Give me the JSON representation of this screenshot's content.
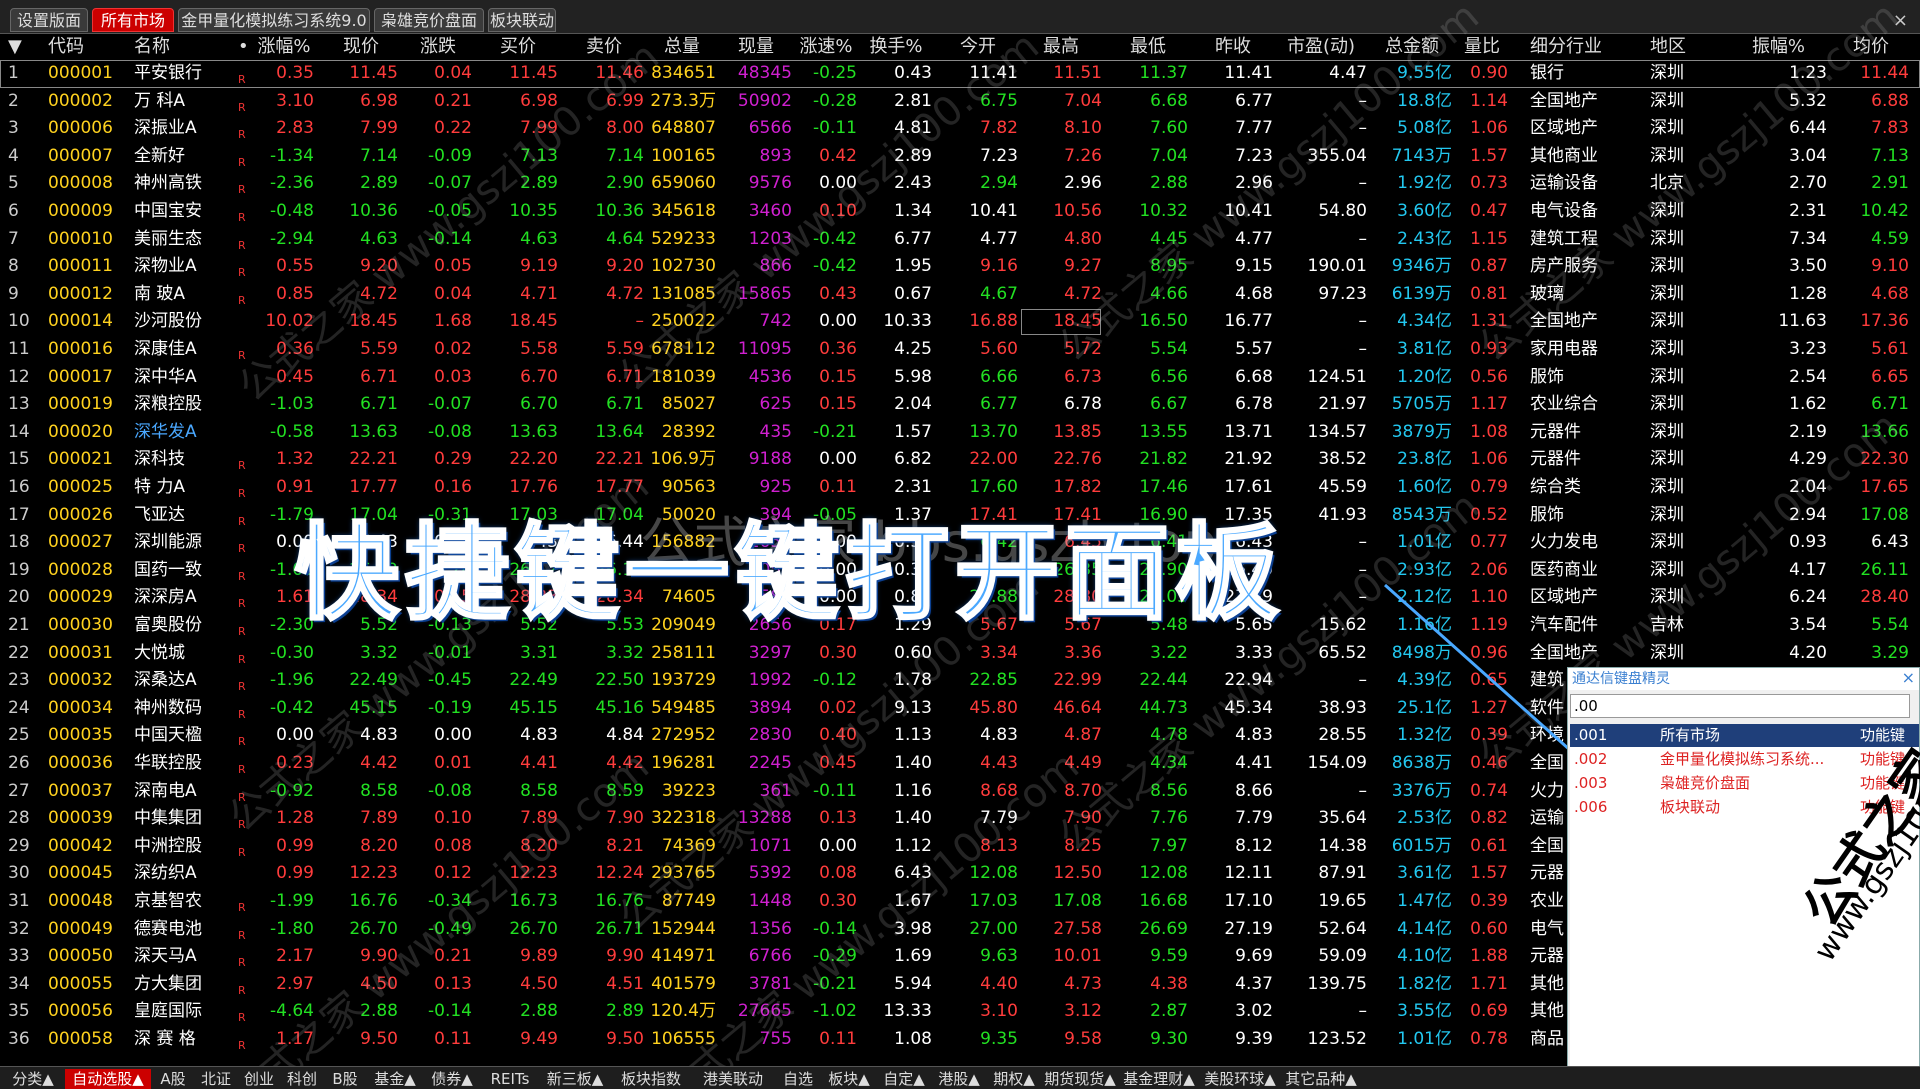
{
  "top_tabs": [
    "设置版面",
    "所有市场",
    "金甲量化模拟练习系统9.0",
    "枭雄竞价盘面",
    "板块联动"
  ],
  "top_active": 1,
  "top_close": "×",
  "headers": [
    "▼",
    "代码",
    "名称",
    "•",
    "涨幅%",
    "现价",
    "涨跌",
    "买价",
    "卖价",
    "总量",
    "现量",
    "涨速%",
    "换手%",
    "今开",
    "最高",
    "最低",
    "昨收",
    "市盈(动)",
    "总金额",
    "量比",
    "细分行业",
    "地区",
    "振幅%",
    "均价"
  ],
  "rows": [
    [
      "1",
      "000001",
      "平安银行",
      "R",
      "0.35",
      "11.45",
      "0.04",
      "11.45",
      "11.46",
      "834651",
      "48345",
      "-0.25",
      "0.43",
      "11.41",
      "11.51",
      "11.37",
      "11.41",
      "4.47",
      "9.55亿",
      "0.90",
      "银行",
      "深圳",
      "1.23",
      "11.44"
    ],
    [
      "2",
      "000002",
      "万 科A",
      "R",
      "3.10",
      "6.98",
      "0.21",
      "6.98",
      "6.99",
      "273.3万",
      "50902",
      "-0.28",
      "2.81",
      "6.75",
      "7.04",
      "6.68",
      "6.77",
      "–",
      "18.8亿",
      "1.14",
      "全国地产",
      "深圳",
      "5.32",
      "6.88"
    ],
    [
      "3",
      "000006",
      "深振业A",
      "R",
      "2.83",
      "7.99",
      "0.22",
      "7.99",
      "8.00",
      "648807",
      "6566",
      "-0.11",
      "4.81",
      "7.82",
      "8.10",
      "7.60",
      "7.77",
      "–",
      "5.08亿",
      "1.06",
      "区域地产",
      "深圳",
      "6.44",
      "7.83"
    ],
    [
      "4",
      "000007",
      "全新好",
      "R",
      "-1.34",
      "7.14",
      "-0.09",
      "7.13",
      "7.14",
      "100165",
      "893",
      "0.42",
      "2.89",
      "7.23",
      "7.26",
      "7.04",
      "7.23",
      "355.04",
      "7143万",
      "1.57",
      "其他商业",
      "深圳",
      "3.04",
      "7.13"
    ],
    [
      "5",
      "000008",
      "神州高铁",
      "R",
      "-2.36",
      "2.89",
      "-0.07",
      "2.89",
      "2.90",
      "659060",
      "9576",
      "0.00",
      "2.43",
      "2.94",
      "2.96",
      "2.88",
      "2.96",
      "–",
      "1.92亿",
      "0.73",
      "运输设备",
      "北京",
      "2.70",
      "2.91"
    ],
    [
      "6",
      "000009",
      "中国宝安",
      "R",
      "-0.48",
      "10.36",
      "-0.05",
      "10.35",
      "10.36",
      "345618",
      "3460",
      "0.10",
      "1.34",
      "10.41",
      "10.56",
      "10.32",
      "10.41",
      "54.80",
      "3.60亿",
      "0.47",
      "电气设备",
      "深圳",
      "2.31",
      "10.42"
    ],
    [
      "7",
      "000010",
      "美丽生态",
      "R",
      "-2.94",
      "4.63",
      "-0.14",
      "4.63",
      "4.64",
      "529233",
      "1203",
      "-0.42",
      "6.77",
      "4.77",
      "4.80",
      "4.45",
      "4.77",
      "–",
      "2.43亿",
      "1.15",
      "建筑工程",
      "深圳",
      "7.34",
      "4.59"
    ],
    [
      "8",
      "000011",
      "深物业A",
      "R",
      "0.55",
      "9.20",
      "0.05",
      "9.19",
      "9.20",
      "102730",
      "866",
      "-0.42",
      "1.95",
      "9.16",
      "9.27",
      "8.95",
      "9.15",
      "190.01",
      "9346万",
      "0.87",
      "房产服务",
      "深圳",
      "3.50",
      "9.10"
    ],
    [
      "9",
      "000012",
      "南 玻A",
      "R",
      "0.85",
      "4.72",
      "0.04",
      "4.71",
      "4.72",
      "131085",
      "15865",
      "0.43",
      "0.67",
      "4.67",
      "4.72",
      "4.66",
      "4.68",
      "97.23",
      "6139万",
      "0.81",
      "玻璃",
      "深圳",
      "1.28",
      "4.68"
    ],
    [
      "10",
      "000014",
      "沙河股份",
      "",
      "10.02",
      "18.45",
      "1.68",
      "18.45",
      "–",
      "250022",
      "742",
      "0.00",
      "10.33",
      "16.88",
      "18.45",
      "16.50",
      "16.77",
      "–",
      "4.34亿",
      "1.31",
      "全国地产",
      "深圳",
      "11.63",
      "17.36"
    ],
    [
      "11",
      "000016",
      "深康佳A",
      "R",
      "0.36",
      "5.59",
      "0.02",
      "5.58",
      "5.59",
      "678112",
      "11095",
      "0.36",
      "4.25",
      "5.60",
      "5.72",
      "5.54",
      "5.57",
      "–",
      "3.81亿",
      "0.93",
      "家用电器",
      "深圳",
      "3.23",
      "5.61"
    ],
    [
      "12",
      "000017",
      "深中华A",
      "",
      "0.45",
      "6.71",
      "0.03",
      "6.70",
      "6.71",
      "181039",
      "4536",
      "0.15",
      "5.98",
      "6.66",
      "6.73",
      "6.56",
      "6.68",
      "124.51",
      "1.20亿",
      "0.56",
      "服饰",
      "深圳",
      "2.54",
      "6.65"
    ],
    [
      "13",
      "000019",
      "深粮控股",
      "",
      "-1.03",
      "6.71",
      "-0.07",
      "6.70",
      "6.71",
      "85027",
      "625",
      "0.15",
      "2.04",
      "6.77",
      "6.78",
      "6.67",
      "6.78",
      "21.97",
      "5705万",
      "1.17",
      "农业综合",
      "深圳",
      "1.62",
      "6.71"
    ],
    [
      "14",
      "000020",
      "深华发A",
      "",
      "-0.58",
      "13.63",
      "-0.08",
      "13.63",
      "13.64",
      "28392",
      "435",
      "-0.21",
      "1.57",
      "13.70",
      "13.85",
      "13.55",
      "13.71",
      "134.57",
      "3879万",
      "1.08",
      "元器件",
      "深圳",
      "2.19",
      "13.66"
    ],
    [
      "15",
      "000021",
      "深科技",
      "R",
      "1.32",
      "22.21",
      "0.29",
      "22.20",
      "22.21",
      "106.9万",
      "9188",
      "0.00",
      "6.82",
      "22.00",
      "22.76",
      "21.82",
      "21.92",
      "38.52",
      "23.8亿",
      "1.06",
      "元器件",
      "深圳",
      "4.29",
      "22.30"
    ],
    [
      "16",
      "000025",
      "特 力A",
      "R",
      "0.91",
      "17.77",
      "0.16",
      "17.76",
      "17.77",
      "90563",
      "925",
      "0.11",
      "2.31",
      "17.60",
      "17.82",
      "17.46",
      "17.61",
      "45.59",
      "1.60亿",
      "0.79",
      "综合类",
      "深圳",
      "2.04",
      "17.65"
    ],
    [
      "17",
      "000026",
      "飞亚达",
      "R",
      "-1.79",
      "17.04",
      "-0.31",
      "17.03",
      "17.04",
      "50020",
      "394",
      "-0.05",
      "1.37",
      "17.41",
      "17.41",
      "16.90",
      "17.35",
      "41.93",
      "8543万",
      "0.52",
      "服饰",
      "深圳",
      "2.94",
      "17.08"
    ],
    [
      "18",
      "000027",
      "深圳能源",
      "R",
      "0.00",
      "6.43",
      "0.00",
      "6.43",
      "6.44",
      "156882",
      "2658",
      "0.00",
      "0.37",
      "6.42",
      "6.45",
      "6.41",
      "6.43",
      "–",
      "1.01亿",
      "0.77",
      "火力发电",
      "深圳",
      "0.93",
      "6.43"
    ],
    [
      "19",
      "000028",
      "国药一致",
      "R",
      "-1.05",
      "26.12",
      "-0.28",
      "26.12",
      "26.13",
      "112023",
      "2054",
      "0.00",
      "0.30",
      "26.35",
      "26.35",
      "25.90",
      "26.40",
      "–",
      "2.93亿",
      "2.06",
      "医药商业",
      "深圳",
      "4.17",
      "26.11"
    ],
    [
      "20",
      "000029",
      "深深房A",
      "R",
      "1.61",
      "28.34",
      "0.45",
      "28.33",
      "28.34",
      "74605",
      "1583",
      "0.00",
      "0.80",
      "27.88",
      "28.80",
      "27.05",
      "27.89",
      "–",
      "2.12亿",
      "1.10",
      "区域地产",
      "深圳",
      "6.24",
      "28.40"
    ],
    [
      "21",
      "000030",
      "富奥股份",
      "R",
      "-2.30",
      "5.52",
      "-0.13",
      "5.52",
      "5.53",
      "209049",
      "2656",
      "0.17",
      "1.29",
      "5.67",
      "5.67",
      "5.48",
      "5.65",
      "15.62",
      "1.16亿",
      "1.19",
      "汽车配件",
      "吉林",
      "3.54",
      "5.54"
    ],
    [
      "22",
      "000031",
      "大悦城",
      "R",
      "-0.30",
      "3.32",
      "-0.01",
      "3.31",
      "3.32",
      "258111",
      "3297",
      "0.30",
      "0.60",
      "3.34",
      "3.36",
      "3.22",
      "3.33",
      "65.52",
      "8498万",
      "0.96",
      "全国地产",
      "深圳",
      "4.20",
      "3.29"
    ],
    [
      "23",
      "000032",
      "深桑达A",
      "R",
      "-1.96",
      "22.49",
      "-0.45",
      "22.49",
      "22.50",
      "193729",
      "1992",
      "-0.12",
      "1.78",
      "22.85",
      "22.99",
      "22.44",
      "22.94",
      "–",
      "4.39亿",
      "0.65",
      "建筑",
      "深圳",
      "",
      ""
    ],
    [
      "24",
      "000034",
      "神州数码",
      "R",
      "-0.42",
      "45.15",
      "-0.19",
      "45.15",
      "45.16",
      "549485",
      "3894",
      "0.02",
      "9.13",
      "45.80",
      "46.64",
      "44.73",
      "45.34",
      "38.93",
      "25.1亿",
      "1.27",
      "软件",
      "",
      "",
      ""
    ],
    [
      "25",
      "000035",
      "中国天楹",
      "R",
      "0.00",
      "4.83",
      "0.00",
      "4.83",
      "4.84",
      "272952",
      "2830",
      "0.40",
      "1.13",
      "4.83",
      "4.87",
      "4.78",
      "4.83",
      "28.55",
      "1.32亿",
      "0.39",
      "环境",
      "",
      "",
      ""
    ],
    [
      "26",
      "000036",
      "华联控股",
      "R",
      "0.23",
      "4.42",
      "0.01",
      "4.41",
      "4.42",
      "196281",
      "2245",
      "0.45",
      "1.40",
      "4.43",
      "4.49",
      "4.34",
      "4.41",
      "154.09",
      "8638万",
      "0.46",
      "全国",
      "",
      "",
      ""
    ],
    [
      "27",
      "000037",
      "深南电A",
      "R",
      "-0.92",
      "8.58",
      "-0.08",
      "8.58",
      "8.59",
      "39223",
      "361",
      "-0.11",
      "1.16",
      "8.68",
      "8.70",
      "8.56",
      "8.66",
      "–",
      "3376万",
      "0.74",
      "火力",
      "",
      "",
      ""
    ],
    [
      "28",
      "000039",
      "中集集团",
      "R",
      "1.28",
      "7.89",
      "0.10",
      "7.89",
      "7.90",
      "322318",
      "13288",
      "0.13",
      "1.40",
      "7.79",
      "7.90",
      "7.76",
      "7.79",
      "35.64",
      "2.53亿",
      "0.82",
      "运输",
      "",
      "",
      ""
    ],
    [
      "29",
      "000042",
      "中洲控股",
      "R",
      "0.99",
      "8.20",
      "0.08",
      "8.20",
      "8.21",
      "74369",
      "1071",
      "0.00",
      "1.12",
      "8.13",
      "8.25",
      "7.97",
      "8.12",
      "14.38",
      "6015万",
      "0.61",
      "全国",
      "",
      "",
      ""
    ],
    [
      "30",
      "000045",
      "深纺织A",
      "",
      "0.99",
      "12.23",
      "0.12",
      "12.23",
      "12.24",
      "293765",
      "5392",
      "0.08",
      "6.43",
      "12.08",
      "12.50",
      "12.08",
      "12.11",
      "87.91",
      "3.61亿",
      "1.57",
      "元器",
      "",
      "",
      ""
    ],
    [
      "31",
      "000048",
      "京基智农",
      "R",
      "-1.99",
      "16.76",
      "-0.34",
      "16.73",
      "16.76",
      "87749",
      "1448",
      "0.30",
      "1.67",
      "17.03",
      "17.08",
      "16.68",
      "17.10",
      "19.65",
      "1.47亿",
      "0.39",
      "农业",
      "",
      "",
      ""
    ],
    [
      "32",
      "000049",
      "德赛电池",
      "R",
      "-1.80",
      "26.70",
      "-0.49",
      "26.70",
      "26.71",
      "152944",
      "1356",
      "-0.14",
      "3.98",
      "27.00",
      "27.58",
      "26.69",
      "27.19",
      "52.64",
      "4.14亿",
      "0.60",
      "电气",
      "",
      "",
      ""
    ],
    [
      "33",
      "000050",
      "深天马A",
      "R",
      "2.17",
      "9.90",
      "0.21",
      "9.89",
      "9.90",
      "414971",
      "6766",
      "-0.29",
      "1.69",
      "9.63",
      "10.01",
      "9.59",
      "9.69",
      "59.09",
      "4.10亿",
      "1.88",
      "元器",
      "",
      "",
      ""
    ],
    [
      "34",
      "000055",
      "方大集团",
      "R",
      "2.97",
      "4.50",
      "0.13",
      "4.50",
      "4.51",
      "401579",
      "3781",
      "-0.21",
      "5.94",
      "4.40",
      "4.73",
      "4.38",
      "4.37",
      "139.75",
      "1.82亿",
      "1.71",
      "其他",
      "",
      "",
      ""
    ],
    [
      "35",
      "000056",
      "皇庭国际",
      "R",
      "-4.64",
      "2.88",
      "-0.14",
      "2.88",
      "2.89",
      "120.4万",
      "27665",
      "-1.02",
      "13.33",
      "3.10",
      "3.12",
      "2.87",
      "3.02",
      "–",
      "3.55亿",
      "0.69",
      "其他",
      "",
      "",
      ""
    ],
    [
      "36",
      "000058",
      "深 赛 格",
      "R",
      "1.17",
      "9.50",
      "0.11",
      "9.49",
      "9.50",
      "106555",
      "755",
      "0.11",
      "1.08",
      "9.35",
      "9.58",
      "9.30",
      "9.39",
      "123.52",
      "1.01亿",
      "0.78",
      "商品",
      "",
      "",
      ""
    ]
  ],
  "bottom_tabs": [
    "分类▲",
    "自动选股▲",
    "A股",
    "北证",
    "创业",
    "科创",
    "B股",
    "基金▲",
    "债券▲",
    "REITs",
    "新三板▲",
    "板块指数",
    "港美联动",
    "自选",
    "板块▲",
    "自定▲",
    "港股▲",
    "期权▲",
    "期货现货▲",
    "基金理财▲",
    "美股环球▲",
    "其它品种▲"
  ],
  "bottom_active": 1,
  "overlay_text": "快捷键一键打开面板",
  "watermark_center": "公式之家 bbs.gszb.top",
  "watermark": "公式之家 www.gszj100.com",
  "watermark_right": "公式之家",
  "watermark_right2": "www.gszj100",
  "sprite": {
    "title": "通达信键盘精灵",
    "close": "×",
    "input_value": ".00",
    "items": [
      {
        "code": ".001",
        "name": "所有市场",
        "type": "功能键"
      },
      {
        "code": ".002",
        "name": "金甲量化模拟练习系统...",
        "type": "功能键"
      },
      {
        "code": ".003",
        "name": "枭雄竞价盘面",
        "type": "功能键"
      },
      {
        "code": ".006",
        "name": "板块联动",
        "type": "功能键"
      }
    ],
    "selected": 0
  }
}
